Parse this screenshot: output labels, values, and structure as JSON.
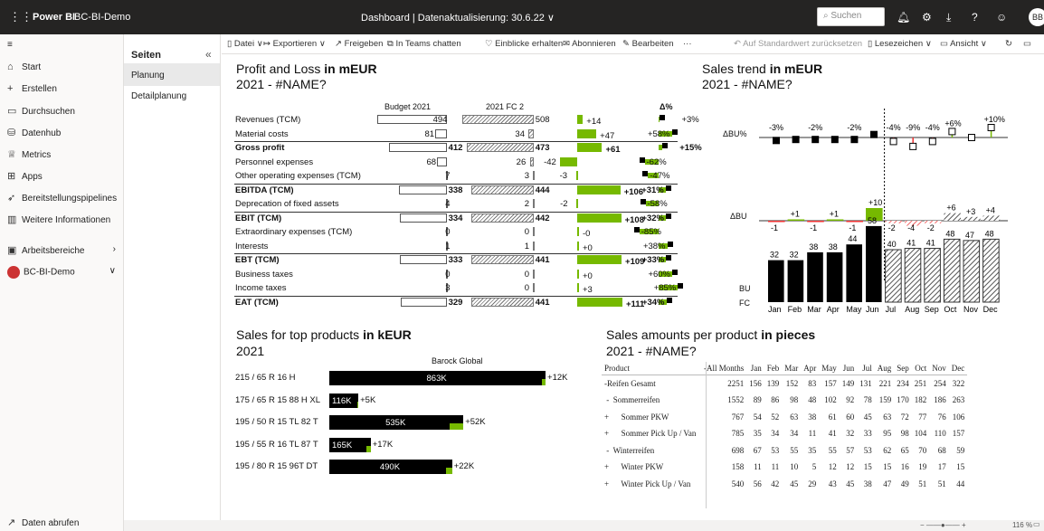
{
  "app": {
    "brand": "Power BI",
    "workspace": "BC-BI-Demo",
    "center": "Dashboard  |  Datenaktualisierung: 30.6.22 ∨",
    "search_placeholder": "Suchen",
    "avatar": "BB"
  },
  "nav": [
    {
      "label": "Start",
      "icon": "home"
    },
    {
      "label": "Erstellen",
      "icon": "plus"
    },
    {
      "label": "Durchsuchen",
      "icon": "folder"
    },
    {
      "label": "Datenhub",
      "icon": "database"
    },
    {
      "label": "Metrics",
      "icon": "trophy"
    },
    {
      "label": "Apps",
      "icon": "apps"
    },
    {
      "label": "Bereitstellungspipelines",
      "icon": "rocket"
    },
    {
      "label": "Weitere Informationen",
      "icon": "book"
    },
    {
      "label": "Arbeitsbereiche",
      "icon": "workspaces"
    },
    {
      "label": "BC-BI-Demo",
      "icon": "org"
    }
  ],
  "nav_bottom": "Daten abrufen",
  "pages": {
    "header": "Seiten",
    "items": [
      "Planung",
      "Detailplanung"
    ]
  },
  "toolbar": {
    "datei": "Datei ∨",
    "export": "Exportieren ∨",
    "share": "Freigeben",
    "teams": "In Teams chatten",
    "insights": "Einblicke erhalten",
    "subscribe": "Abonnieren",
    "edit": "Bearbeiten",
    "more": "···",
    "reset": "Auf Standardwert zurücksetzen",
    "bookmarks": "Lesezeichen ∨",
    "view": "Ansicht ∨"
  },
  "zoom": "116 %",
  "pl": {
    "title_a": "Profit and Loss ",
    "title_b": "in mEUR",
    "subtitle": "2021 - #NAME?",
    "col_budget": "Budget 2021",
    "col_fc": "2021 FC 2",
    "col_dpct": "Δ%",
    "rows": [
      {
        "label": "Revenues (TCM)",
        "bold": false,
        "budget": 494,
        "fc": 508,
        "delta": "+14",
        "dval": 14,
        "pct": "+3%",
        "pval": 3
      },
      {
        "label": "Material costs",
        "bold": false,
        "budget": 81,
        "fc": 34,
        "delta": "+47",
        "dval": 47,
        "pct": "+58%",
        "pval": 58
      },
      {
        "label": "Gross profit",
        "bold": true,
        "budget": 412,
        "fc": 473,
        "delta": "+61",
        "dval": 61,
        "pct": "+15%",
        "pval": 15
      },
      {
        "label": "Personnel expenses",
        "bold": false,
        "budget": 68,
        "fc": 26,
        "delta": "-42",
        "dval": -42,
        "pct": "-62%",
        "pval": -62
      },
      {
        "label": "Other operating expenses (TCM)",
        "bold": false,
        "budget": 7,
        "fc": 3,
        "delta": "-3",
        "dval": -3,
        "pct": "-47%",
        "pval": -47
      },
      {
        "label": "EBITDA (TCM)",
        "bold": true,
        "budget": 338,
        "fc": 444,
        "delta": "+106",
        "dval": 106,
        "pct": "+31%",
        "pval": 31
      },
      {
        "label": "Deprecation of fixed assets",
        "bold": false,
        "budget": 4,
        "fc": 2,
        "delta": "-2",
        "dval": -2,
        "pct": "-58%",
        "pval": -58
      },
      {
        "label": "EBIT (TCM)",
        "bold": true,
        "budget": 334,
        "fc": 442,
        "delta": "+108",
        "dval": 108,
        "pct": "+32%",
        "pval": 32
      },
      {
        "label": "Extraordinary expenses (TCM)",
        "bold": false,
        "budget": 0,
        "fc": 0,
        "delta": "-0",
        "dval": 0,
        "pct": "-85%",
        "pval": -85
      },
      {
        "label": "Interests",
        "bold": false,
        "budget": 1,
        "fc": 1,
        "delta": "+0",
        "dval": 0,
        "pct": "+38%",
        "pval": 38
      },
      {
        "label": "EBT (TCM)",
        "bold": true,
        "budget": 333,
        "fc": 441,
        "delta": "+109",
        "dval": 109,
        "pct": "+33%",
        "pval": 33
      },
      {
        "label": "Business taxes",
        "bold": false,
        "budget": 0,
        "fc": 0,
        "delta": "+0",
        "dval": 0,
        "pct": "+60%",
        "pval": 60
      },
      {
        "label": "Income taxes",
        "bold": false,
        "budget": 3,
        "fc": 0,
        "delta": "+3",
        "dval": 3,
        "pct": "+85%",
        "pval": 85
      },
      {
        "label": "EAT (TCM)",
        "bold": true,
        "budget": 329,
        "fc": 441,
        "delta": "+111",
        "dval": 111,
        "pct": "+34%",
        "pval": 34
      }
    ]
  },
  "trend": {
    "title_a": "Sales trend ",
    "title_b": "in mEUR",
    "subtitle": "2021 - #NAME?",
    "lbl_dbupct": "ΔBU%",
    "lbl_dbu": "ΔBU",
    "lbl_bu": "BU",
    "lbl_fc": "FC",
    "months": [
      "Jan",
      "Feb",
      "Mar",
      "Apr",
      "May",
      "Jun",
      "Jul",
      "Aug",
      "Sep",
      "Oct",
      "Nov",
      "Dec"
    ],
    "values": [
      32,
      32,
      38,
      38,
      44,
      58,
      40,
      41,
      41,
      48,
      47,
      48
    ],
    "actual_count": 6,
    "dbu": [
      -1,
      1,
      -1,
      1,
      -1,
      10,
      -2,
      -4,
      -2,
      6,
      3,
      4
    ],
    "dbu_labels": [
      "-1",
      "+1",
      "-1",
      "+1",
      "-1",
      "+10",
      "-2",
      "-4",
      "-2",
      "+6",
      "+3",
      "+4"
    ],
    "dbupct": [
      -3,
      -2,
      -2,
      -2,
      -2,
      3,
      -4,
      -9,
      -4,
      6,
      0,
      10
    ],
    "dbupct_labels": [
      "-3%",
      "",
      "-2%",
      "",
      "-2%",
      "",
      "-4%",
      "-9%",
      "-4%",
      "+6%",
      "",
      "+10%"
    ]
  },
  "top": {
    "title_a": "Sales for top products ",
    "title_b": "in kEUR",
    "subtitle": "2021",
    "legend": "Barock Global",
    "rows": [
      {
        "label": "215 / 65 R 16 H",
        "value": 863,
        "vlabel": "863K",
        "delta": "+12K",
        "dval": 12
      },
      {
        "label": "175 / 65 R 15 88 H XL",
        "value": 116,
        "vlabel": "116K",
        "delta": "+5K",
        "dval": 5
      },
      {
        "label": "195 / 50 R 15 TL 82 T",
        "value": 535,
        "vlabel": "535K",
        "delta": "+52K",
        "dval": 52
      },
      {
        "label": "195 / 55 R 16 TL 87 T",
        "value": 165,
        "vlabel": "165K",
        "delta": "+17K",
        "dval": 17
      },
      {
        "label": "195 / 80 R 15 96T DT",
        "value": 490,
        "vlabel": "490K",
        "delta": "+22K",
        "dval": 22
      }
    ]
  },
  "amounts": {
    "title_a": "Sales amounts per product ",
    "title_b": "in pieces",
    "subtitle": "2021 - #NAME?",
    "headers": [
      "Product",
      "-All Months",
      "Jan",
      "Feb",
      "Mar",
      "Apr",
      "May",
      "Jun",
      "Jul",
      "Aug",
      "Sep",
      "Oct",
      "Nov",
      "Dec"
    ],
    "rows": [
      [
        "-Reifen Gesamt",
        "2251",
        "156",
        "139",
        "152",
        "83",
        "157",
        "149",
        "131",
        "221",
        "234",
        "251",
        "254",
        "322"
      ],
      [
        " -  Sommerreifen",
        "1552",
        "89",
        "86",
        "98",
        "48",
        "102",
        "92",
        "78",
        "159",
        "170",
        "182",
        "186",
        "263"
      ],
      [
        "+      Sommer PKW",
        "767",
        "54",
        "52",
        "63",
        "38",
        "61",
        "60",
        "45",
        "63",
        "72",
        "77",
        "76",
        "106"
      ],
      [
        "+      Sommer Pick Up / Van",
        "785",
        "35",
        "34",
        "34",
        "11",
        "41",
        "32",
        "33",
        "95",
        "98",
        "104",
        "110",
        "157"
      ],
      [
        " -  Winterreifen",
        "698",
        "67",
        "53",
        "55",
        "35",
        "55",
        "57",
        "53",
        "62",
        "65",
        "70",
        "68",
        "59"
      ],
      [
        "+      Winter PKW",
        "158",
        "11",
        "11",
        "10",
        "5",
        "12",
        "12",
        "15",
        "15",
        "16",
        "19",
        "17",
        "15"
      ],
      [
        "+      Winter Pick Up / Van",
        "540",
        "56",
        "42",
        "45",
        "29",
        "43",
        "45",
        "38",
        "47",
        "49",
        "51",
        "51",
        "44"
      ]
    ]
  }
}
